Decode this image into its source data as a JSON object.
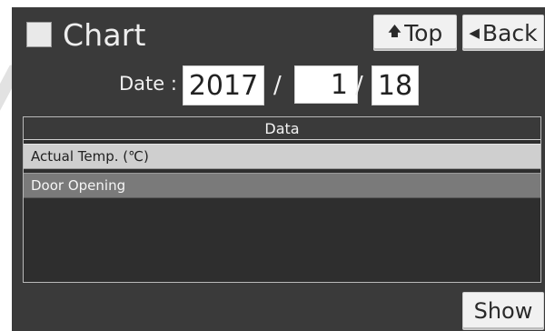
{
  "header": {
    "title": "Chart",
    "top_button": {
      "icon": "up-arrow-icon",
      "label": "Top"
    },
    "back_button": {
      "icon": "left-triangle-icon",
      "label": "Back"
    }
  },
  "date": {
    "label": "Date :",
    "year": "2017",
    "month": "1",
    "day": "18",
    "separator": "/"
  },
  "data_panel": {
    "header": "Data",
    "items": [
      {
        "label": "Actual Temp. (℃)",
        "selected": true
      },
      {
        "label": "Door Opening",
        "selected": false
      }
    ]
  },
  "footer": {
    "show_button": "Show"
  },
  "colors": {
    "screen_bg": "#3a3a3a",
    "panel_bg": "#2e2e2e",
    "selected_item": "#cfcfcf",
    "normal_item": "#7a7a7a",
    "button_bg": "#f1f1f1"
  }
}
